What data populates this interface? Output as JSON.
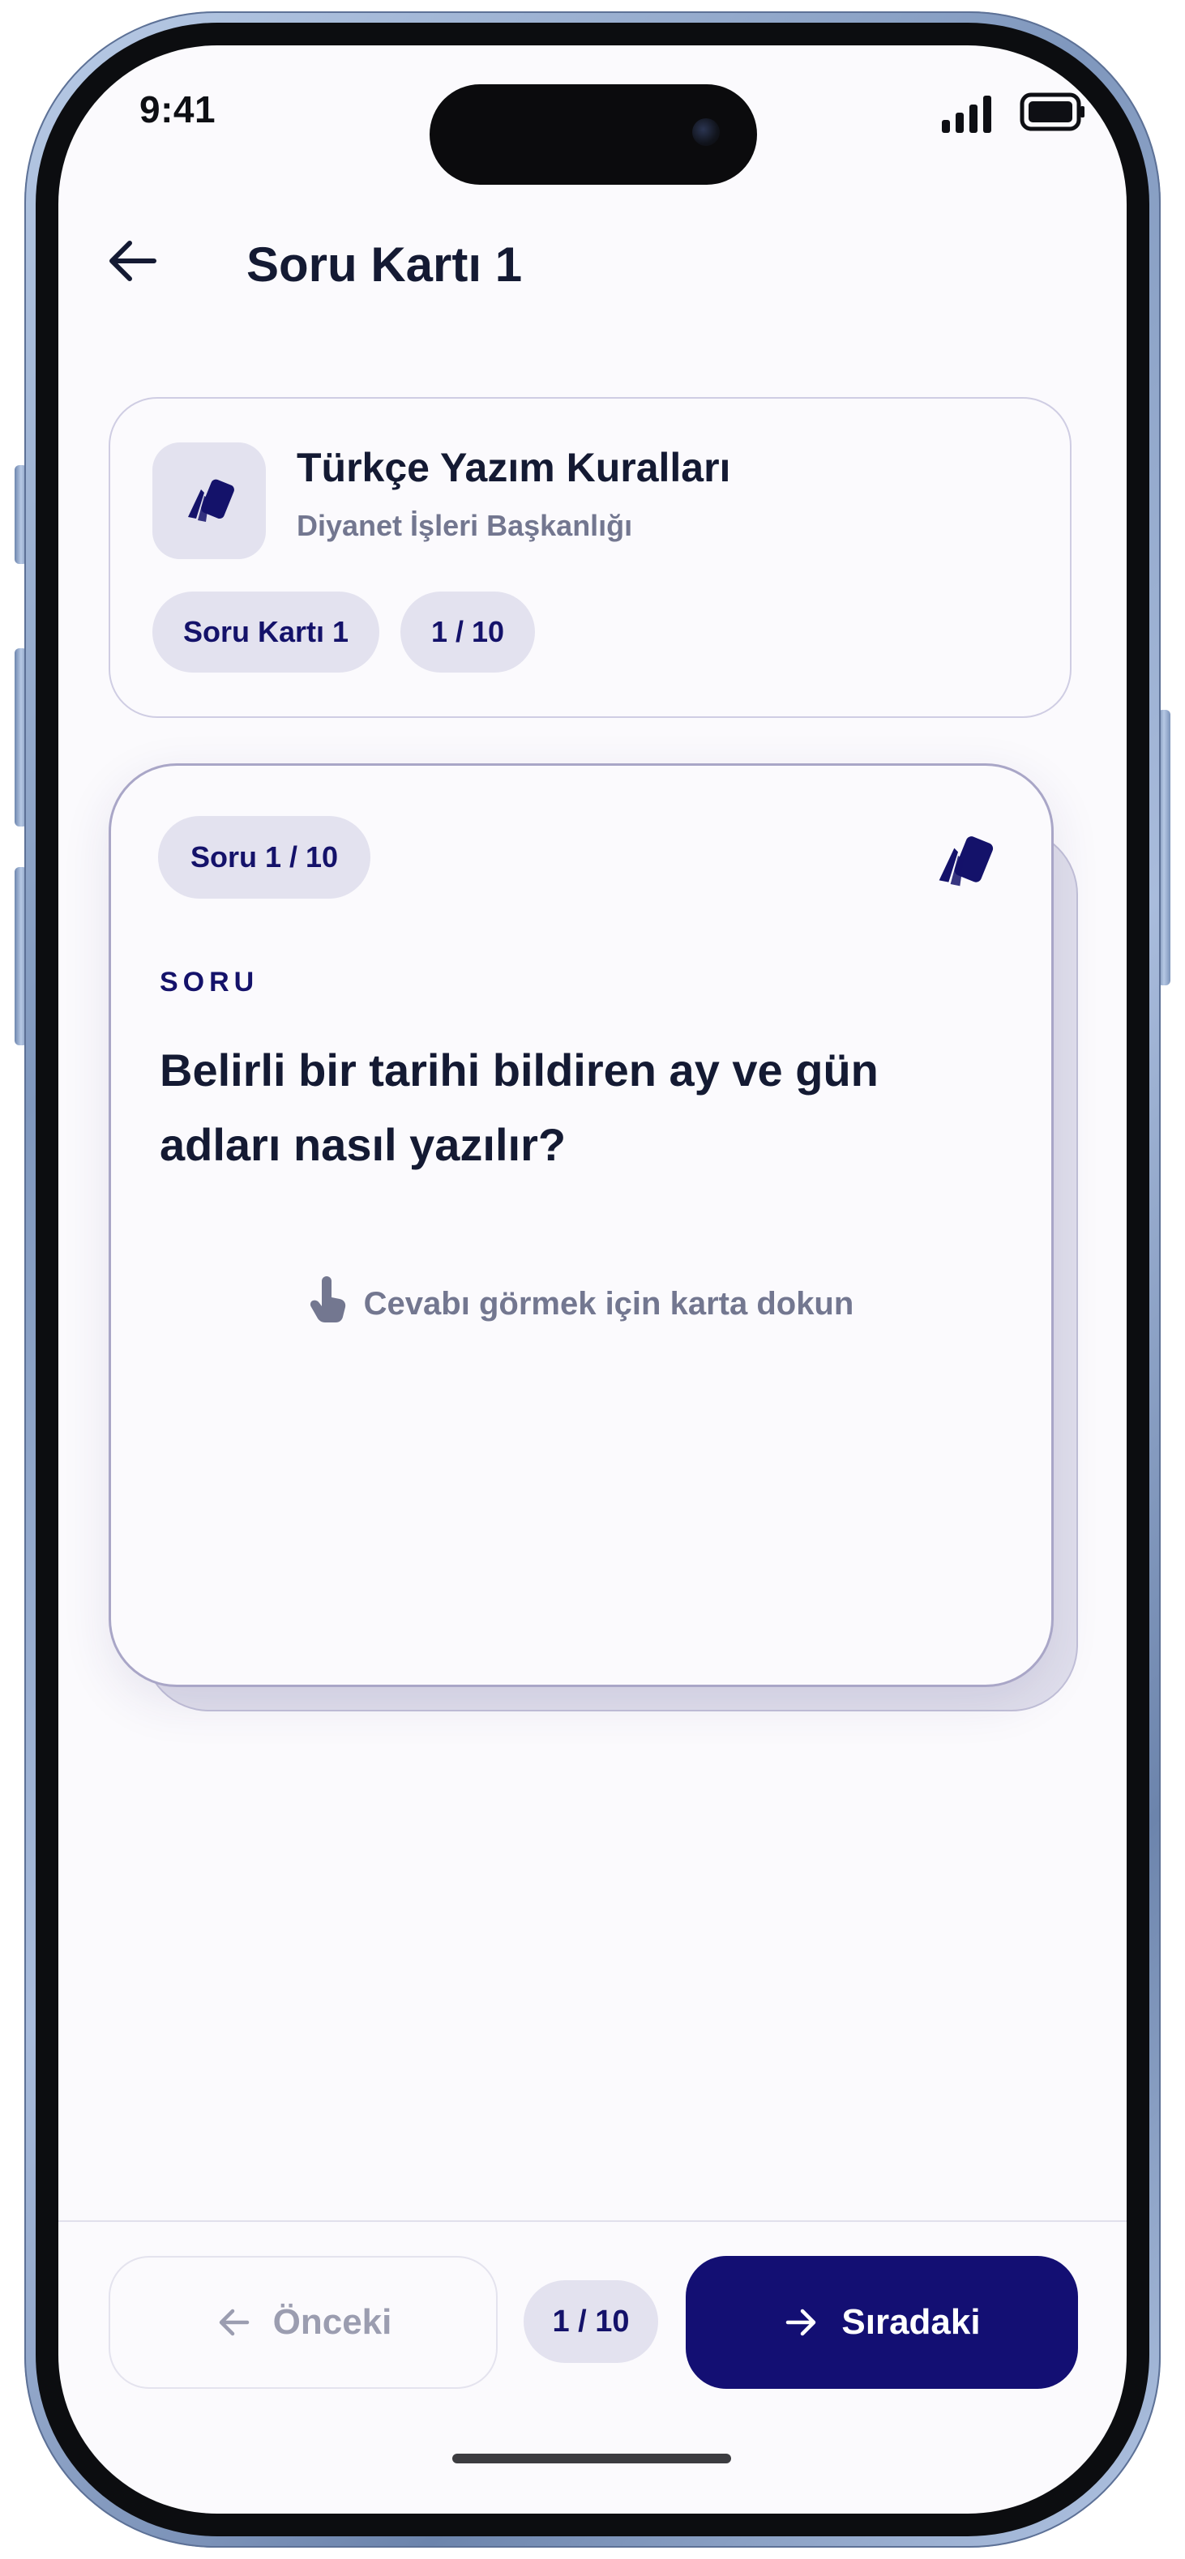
{
  "status_bar": {
    "time": "9:41"
  },
  "header": {
    "title": "Soru Kartı 1",
    "back_icon": "arrow-left-icon"
  },
  "deck": {
    "title": "Türkçe Yazım Kuralları",
    "subtitle": "Diyanet İşleri Başkanlığı",
    "icon": "cards-icon",
    "chips": {
      "set_name": "Soru Kartı 1",
      "progress": "1 / 10"
    }
  },
  "flashcard": {
    "question_chip": "Soru 1 / 10",
    "section_label": "SORU",
    "question": "Belirli bir tarihi bildiren ay ve gün adları nasıl yazılır?",
    "hint": "Cevabı görmek için karta dokun",
    "hint_icon": "tap-hand-icon",
    "corner_icon": "cards-icon"
  },
  "footer": {
    "prev_label": "Önceki",
    "counter": "1 / 10",
    "next_label": "Sıradaki",
    "prev_icon": "arrow-left-icon",
    "next_icon": "arrow-right-icon"
  },
  "colors": {
    "primary": "#130f73",
    "chip_bg": "#e3e2ef",
    "text_dark": "#141a33",
    "text_muted": "#737790"
  }
}
